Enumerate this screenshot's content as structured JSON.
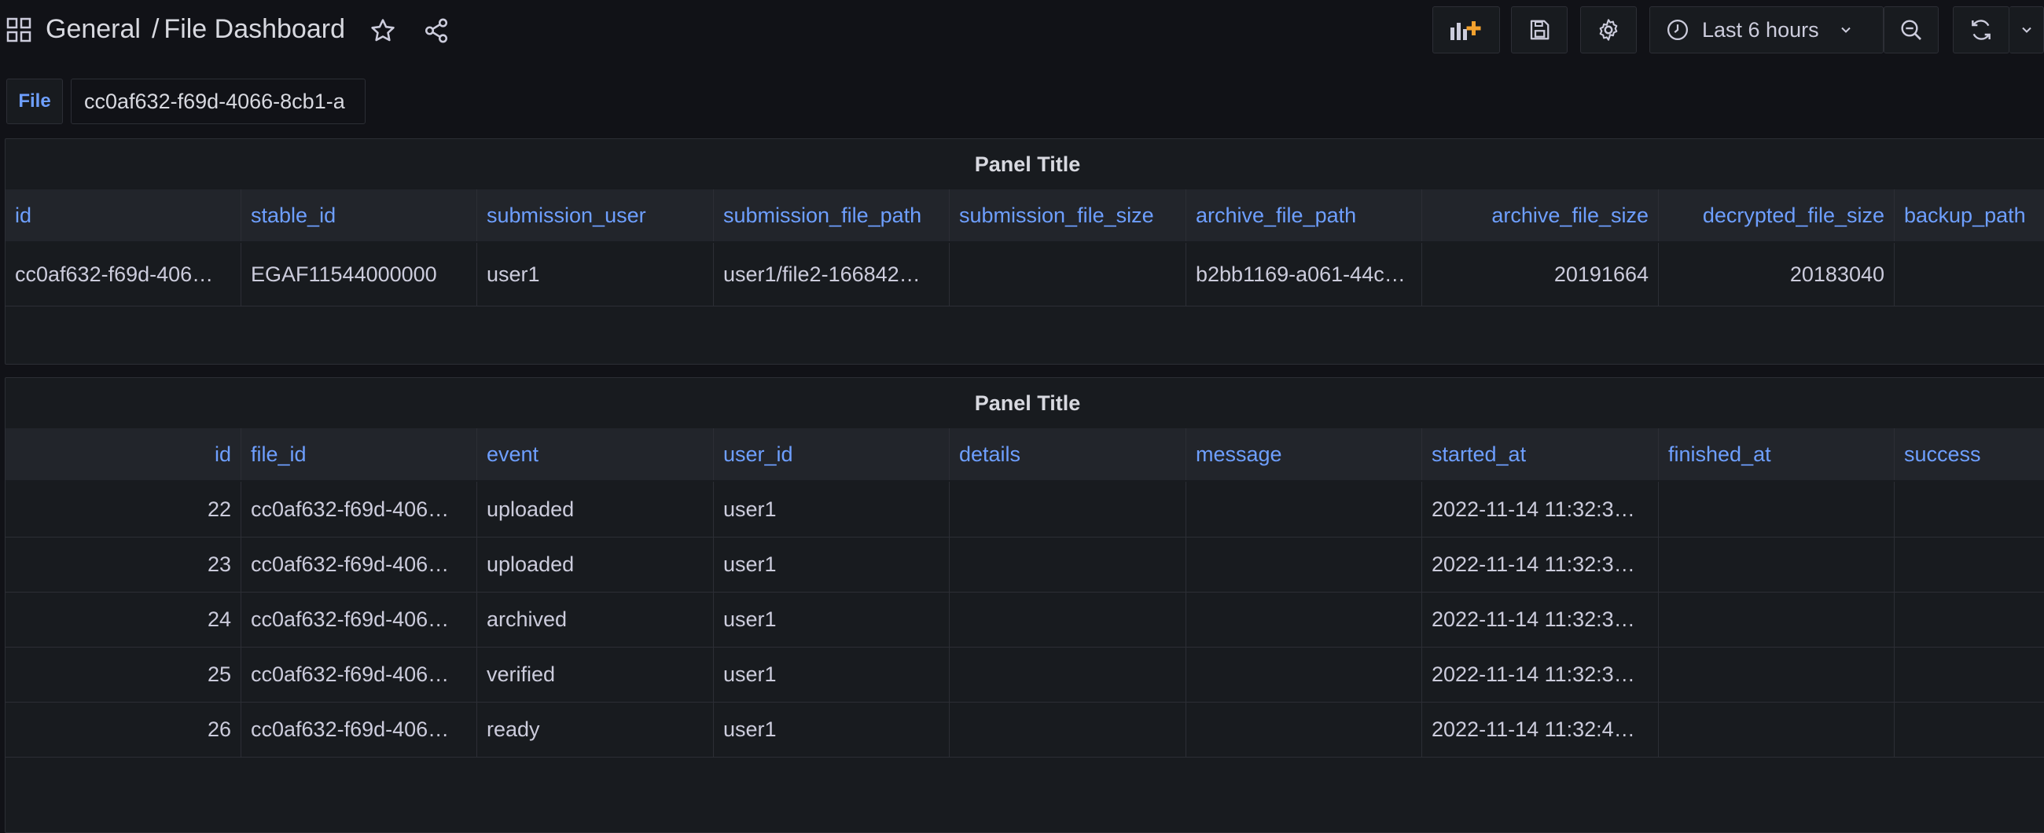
{
  "header": {
    "breadcrumb_folder": "General",
    "breadcrumb_separator": "/",
    "dashboard_title": "File Dashboard",
    "time_range": "Last 6 hours"
  },
  "variables": {
    "file_label": "File",
    "file_value": "cc0af632-f69d-4066-8cb1-a"
  },
  "panel1": {
    "title": "Panel Title",
    "columns": [
      "id",
      "stable_id",
      "submission_user",
      "submission_file_path",
      "submission_file_size",
      "archive_file_path",
      "archive_file_size",
      "decrypted_file_size",
      "backup_path"
    ],
    "rows": [
      [
        "cc0af632-f69d-406…",
        "EGAF11544000000",
        "user1",
        "user1/file2-166842…",
        "",
        "b2bb1169-a061-44c…",
        "20191664",
        "20183040",
        ""
      ]
    ]
  },
  "panel2": {
    "title": "Panel Title",
    "columns": [
      "id",
      "file_id",
      "event",
      "user_id",
      "details",
      "message",
      "started_at",
      "finished_at",
      "success"
    ],
    "rows": [
      [
        "22",
        "cc0af632-f69d-406…",
        "uploaded",
        "user1",
        "",
        "",
        "2022-11-14 11:32:3…",
        "",
        ""
      ],
      [
        "23",
        "cc0af632-f69d-406…",
        "uploaded",
        "user1",
        "",
        "",
        "2022-11-14 11:32:3…",
        "",
        ""
      ],
      [
        "24",
        "cc0af632-f69d-406…",
        "archived",
        "user1",
        "",
        "",
        "2022-11-14 11:32:3…",
        "",
        ""
      ],
      [
        "25",
        "cc0af632-f69d-406…",
        "verified",
        "user1",
        "",
        "",
        "2022-11-14 11:32:3…",
        "",
        ""
      ],
      [
        "26",
        "cc0af632-f69d-406…",
        "ready",
        "user1",
        "",
        "",
        "2022-11-14 11:32:4…",
        "",
        ""
      ]
    ]
  },
  "colors": {
    "background": "#111217",
    "panel": "#181b1f",
    "accent": "#6e9fff",
    "add_panel_accent": "#f2a12e"
  }
}
